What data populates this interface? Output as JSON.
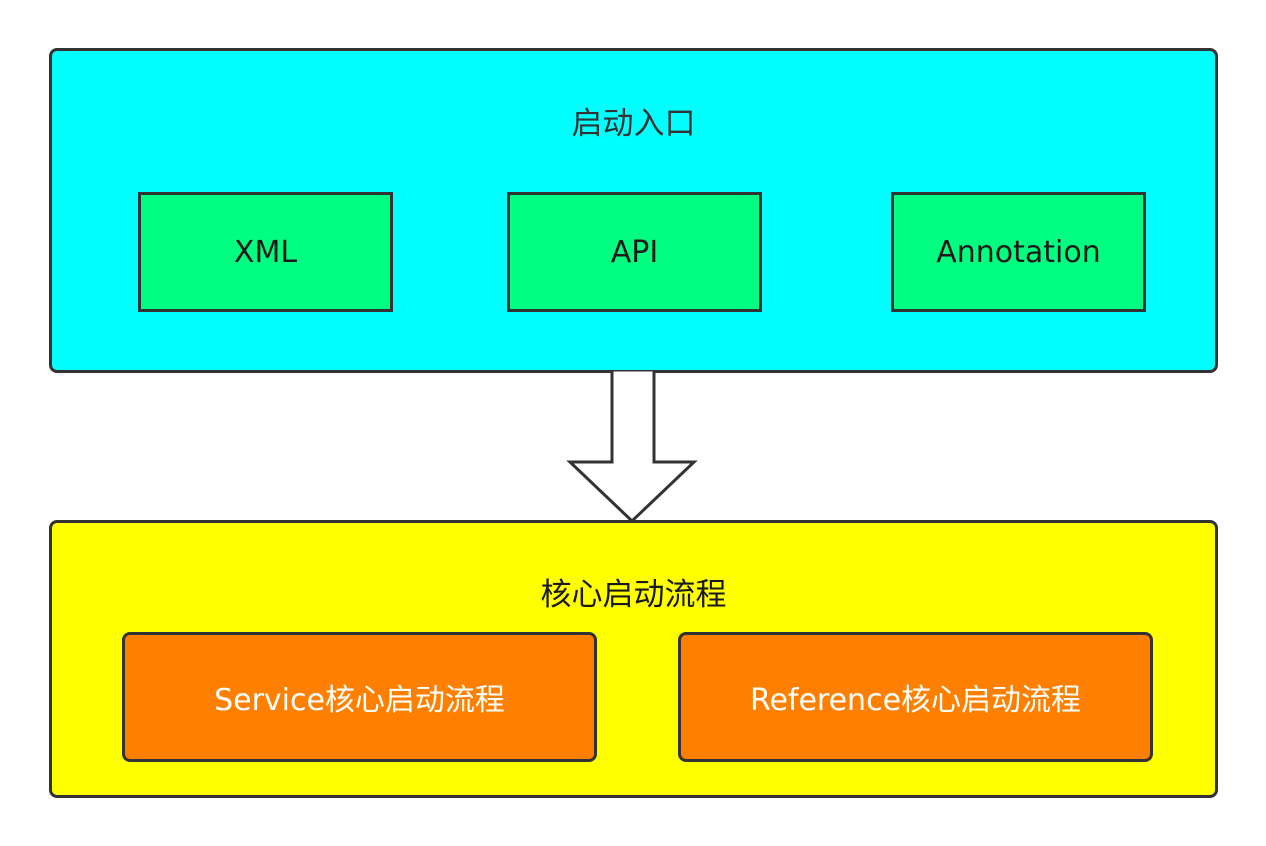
{
  "diagram": {
    "entry_panel": {
      "title": "启动入口",
      "items": [
        "XML",
        "API",
        "Annotation"
      ],
      "color": "#00ffff",
      "item_color": "#00ff80"
    },
    "core_panel": {
      "title": "核心启动流程",
      "items": [
        "Service核心启动流程",
        "Reference核心启动流程"
      ],
      "color": "#ffff00",
      "item_color": "#ff8000"
    },
    "connector": "down-arrow-icon"
  }
}
